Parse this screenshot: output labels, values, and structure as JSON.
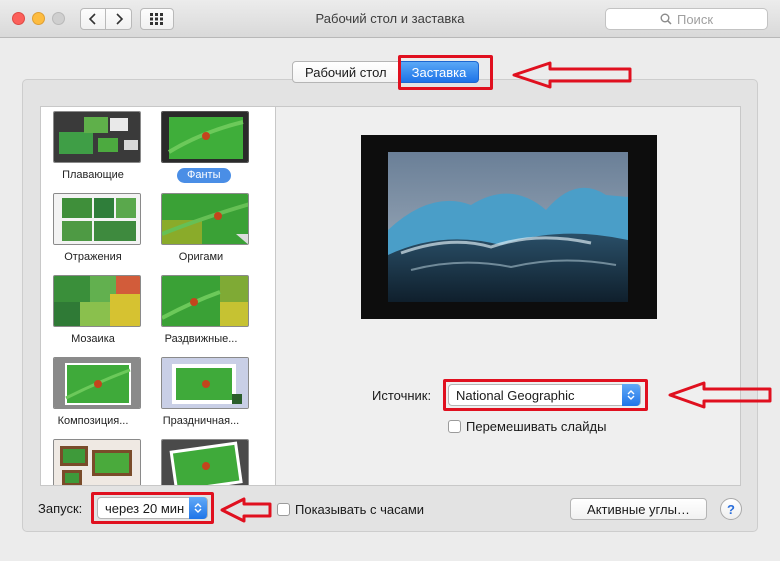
{
  "window": {
    "title": "Рабочий стол и заставка",
    "search_placeholder": "Поиск"
  },
  "tabs": [
    {
      "label": "Рабочий стол",
      "selected": false
    },
    {
      "label": "Заставка",
      "selected": true
    }
  ],
  "screensavers": [
    {
      "label": "Плавающие",
      "selected": false
    },
    {
      "label": "Фанты",
      "selected": true
    },
    {
      "label": "Отражения",
      "selected": false
    },
    {
      "label": "Оригами",
      "selected": false
    },
    {
      "label": "Мозаика",
      "selected": false
    },
    {
      "label": "Раздвижные...",
      "selected": false
    },
    {
      "label": "Композиция...",
      "selected": false
    },
    {
      "label": "Праздничная...",
      "selected": false
    }
  ],
  "source": {
    "label": "Источник:",
    "value": "National Geographic"
  },
  "shuffle": {
    "label": "Перемешивать слайды",
    "checked": false
  },
  "start": {
    "label": "Запуск:",
    "value": "через 20 мин"
  },
  "show_clock": {
    "label": "Показывать с часами",
    "checked": false
  },
  "hot_corners_label": "Активные углы…",
  "help_label": "?",
  "colors": {
    "accent": "#1d73e8",
    "annotation": "#e0101f"
  }
}
